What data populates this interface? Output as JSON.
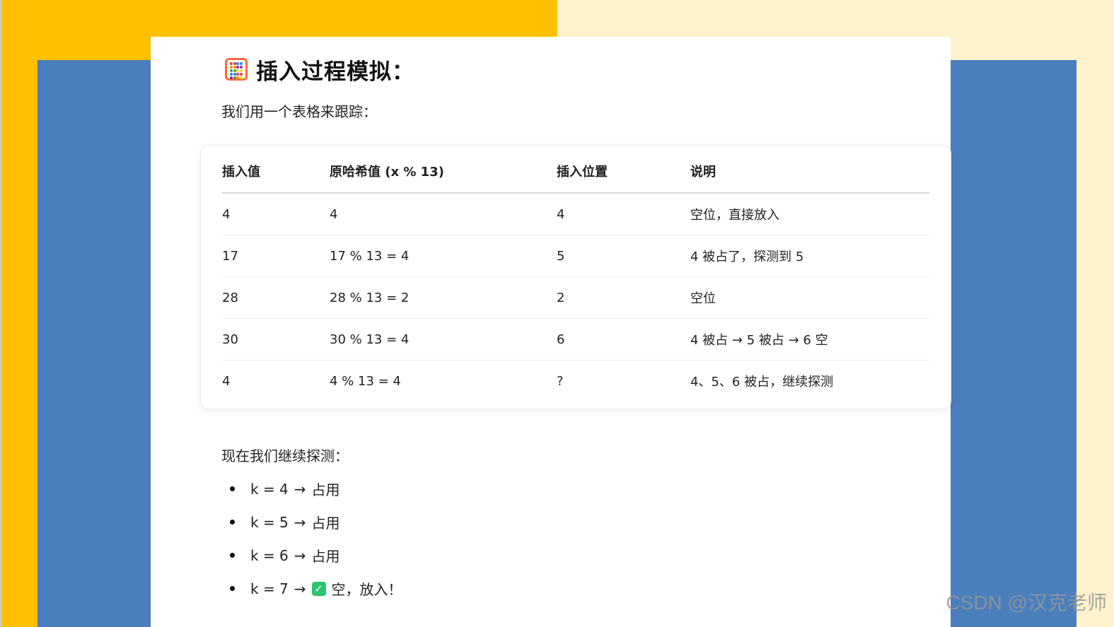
{
  "heading": {
    "icon": "abacus-icon",
    "title": "插入过程模拟："
  },
  "intro": "我们用一个表格来跟踪：",
  "table": {
    "headers": [
      "插入值",
      "原哈希值 (x % 13)",
      "插入位置",
      "说明"
    ],
    "rows": [
      [
        "4",
        "4",
        "4",
        "空位，直接放入"
      ],
      [
        "17",
        "17 % 13 = 4",
        "5",
        "4 被占了，探测到 5"
      ],
      [
        "28",
        "28 % 13 = 2",
        "2",
        "空位"
      ],
      [
        "30",
        "30 % 13 = 4",
        "6",
        "4 被占 → 5 被占 → 6 空"
      ],
      [
        "4",
        "4 % 13 = 4",
        "?",
        "4、5、6 被占，继续探测"
      ]
    ]
  },
  "probe": {
    "intro": "现在我们继续探测：",
    "items": [
      {
        "key": "k = 4",
        "arrow": "→",
        "result": "占用",
        "icon": ""
      },
      {
        "key": "k = 5",
        "arrow": "→",
        "result": "占用",
        "icon": ""
      },
      {
        "key": "k = 6",
        "arrow": "→",
        "result": "占用",
        "icon": ""
      },
      {
        "key": "k = 7",
        "arrow": "→",
        "result": "空，放入！",
        "icon": "check-mark-icon"
      }
    ]
  },
  "watermark": "CSDN @汉克老师",
  "colors": {
    "yellow": "#ffc000",
    "cream": "#fff2cc",
    "blue": "#4a7ebd",
    "check": "#2bc46b"
  }
}
